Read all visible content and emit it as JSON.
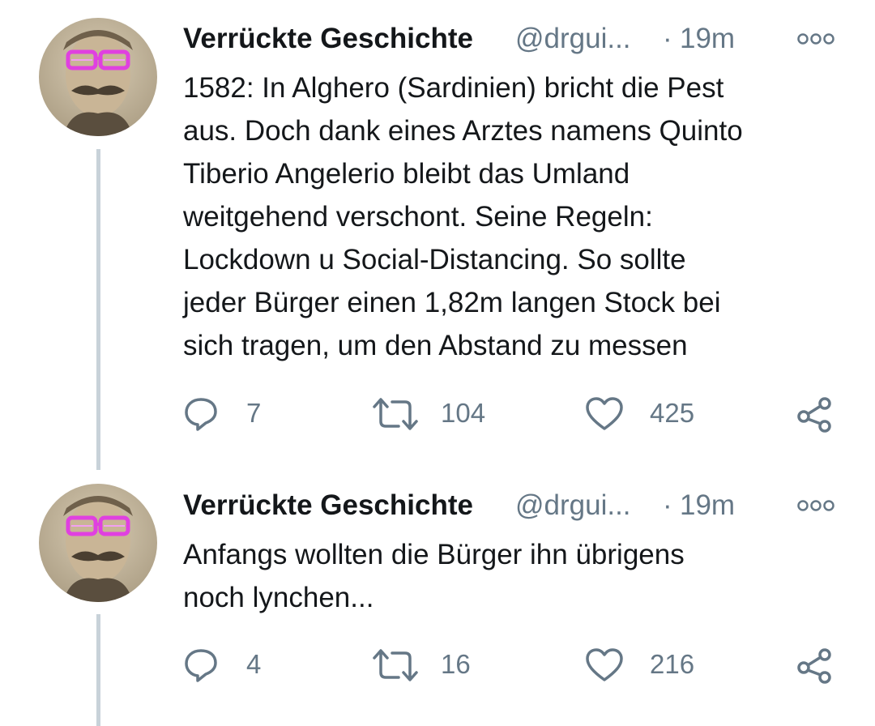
{
  "tweets": [
    {
      "display_name": "Verrückte Geschichte",
      "handle": "@drgui...",
      "time_sep": "·",
      "time": "19m",
      "text": "1582: In Alghero (Sardinien) bricht die Pest\naus. Doch dank  eines Arztes namens Quinto\nTiberio Angelerio bleibt das Umland\nweitgehend verschont. Seine Regeln:\nLockdown u Social-Distancing. So sollte\njeder Bürger einen 1,82m langen Stock bei\nsich tragen, um den Abstand zu messen",
      "replies": "7",
      "retweets": "104",
      "likes": "425"
    },
    {
      "display_name": "Verrückte Geschichte",
      "handle": "@drgui...",
      "time_sep": "·",
      "time": "19m",
      "text": "Anfangs wollten die Bürger ihn übrigens\nnoch lynchen...",
      "replies": "4",
      "retweets": "16",
      "likes": "216"
    }
  ],
  "icons": {
    "reply": "reply-icon",
    "retweet": "retweet-icon",
    "like": "heart-icon",
    "share": "share-icon",
    "more": "more-options-icon"
  },
  "colors": {
    "text": "#14171a",
    "secondary": "#657786",
    "thread_line": "#c8d2d9",
    "glasses": "#e040e0"
  }
}
